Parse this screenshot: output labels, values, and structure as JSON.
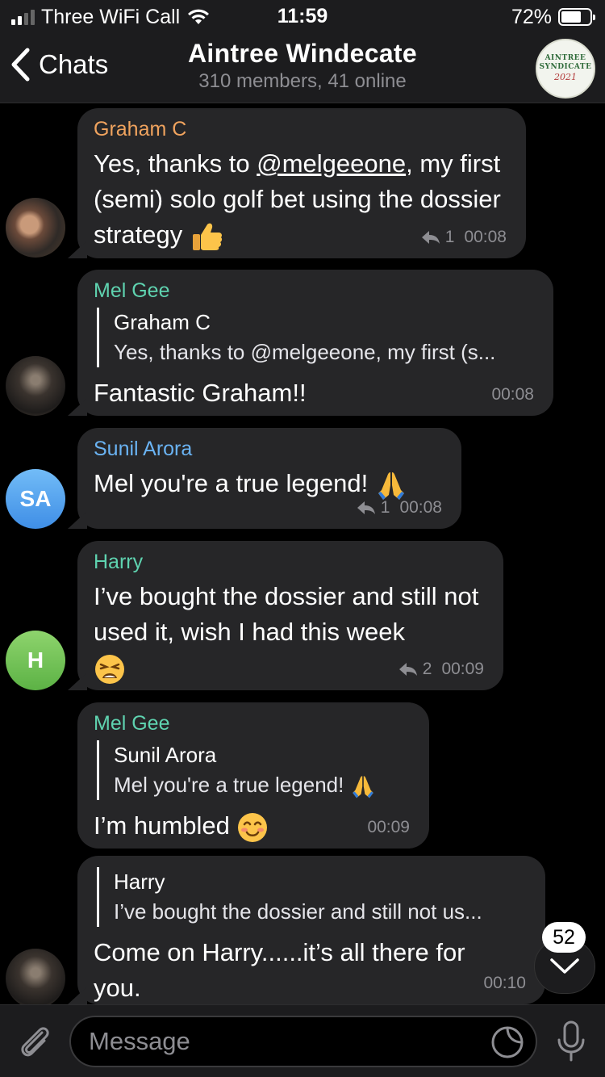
{
  "status_bar": {
    "carrier": "Three WiFi Call",
    "time": "11:59",
    "battery": "72%",
    "battery_level": 0.72
  },
  "header": {
    "back_label": "Chats",
    "title": "Aintree Windecate",
    "subtitle": "310 members, 41 online",
    "avatar_lines": [
      "AINTREE",
      "SYNDICATE",
      "2021"
    ]
  },
  "messages": [
    {
      "sender": "Graham C",
      "sender_color": "#f0a35e",
      "text_before": "Yes, thanks to ",
      "mention": "@melgeeone",
      "text_after": ", my first (semi) solo golf bet using the dossier strategy",
      "emoji": "thumbs-up",
      "replies": "1",
      "time": "00:08"
    },
    {
      "sender": "Mel Gee",
      "sender_color": "#5fd3b0",
      "quote_name": "Graham C",
      "quote_text": "Yes, thanks to @melgeeone, my first (s...",
      "text": "Fantastic Graham!!",
      "time": "00:08"
    },
    {
      "sender": "Sunil Arora",
      "sender_color": "#6ab3f3",
      "avatar_initials": "SA",
      "text": "Mel you're a true legend!",
      "emoji": "folded-hands",
      "replies": "1",
      "time": "00:08"
    },
    {
      "sender": "Harry",
      "sender_color": "#5fd3b0",
      "avatar_initials": "H",
      "text": "I’ve bought the dossier and still not used it, wish I had this week",
      "emoji": "weary-face",
      "replies": "2",
      "time": "00:09"
    },
    {
      "sender": "Mel Gee",
      "sender_color": "#5fd3b0",
      "quote_name": "Sunil Arora",
      "quote_text": "Mel you're a true legend!",
      "quote_emoji": "folded-hands",
      "text": "I’m humbled",
      "emoji": "smiling-face",
      "time": "00:09"
    },
    {
      "quote_name": "Harry",
      "quote_text": "I’ve bought the dossier and still not us...",
      "text": "Come on Harry......it’s all there for you.",
      "time": "00:10"
    }
  ],
  "scroll_badge": "52",
  "input": {
    "placeholder": "Message"
  },
  "colors": {
    "bubble": "#262628",
    "background": "#000000",
    "bar": "#1c1c1e",
    "meta": "#8e8e93"
  }
}
